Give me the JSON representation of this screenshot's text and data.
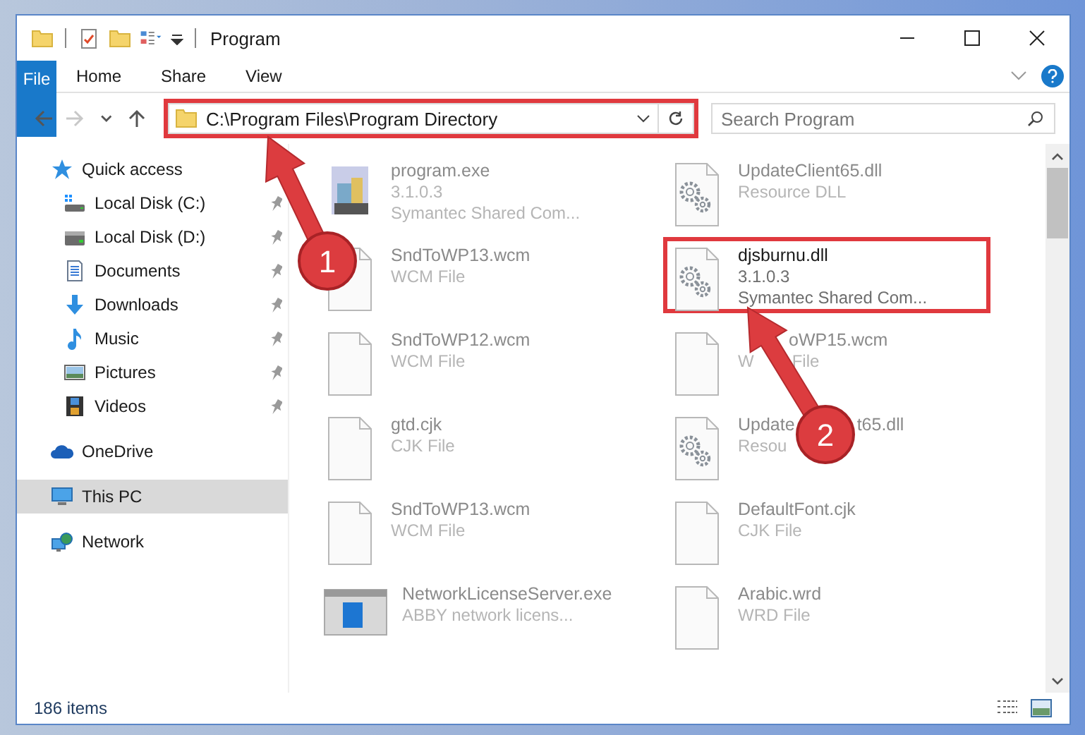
{
  "window": {
    "title": "Program"
  },
  "ribbon_tabs": [
    {
      "label": "File",
      "kind": "file"
    },
    {
      "label": "Home",
      "kind": "tab"
    },
    {
      "label": "Share",
      "kind": "tab"
    },
    {
      "label": "View",
      "kind": "tab"
    }
  ],
  "nav_buttons": [
    {
      "kind": "back",
      "disabled": false
    },
    {
      "kind": "forward",
      "disabled": true
    },
    {
      "kind": "recent",
      "disabled": false
    },
    {
      "kind": "up",
      "disabled": false
    }
  ],
  "address": {
    "value": "C:\\Program Files\\Program Directory",
    "highlighted": true
  },
  "search": {
    "placeholder": "Search Program"
  },
  "sidebar": {
    "items": [
      {
        "label": "Quick access",
        "kind": "star",
        "selected": false,
        "children": [
          {
            "label": "Local Disk (C:)",
            "kind": "drive-c",
            "pinned": true,
            "selected": false
          },
          {
            "label": "Local Disk (D:)",
            "kind": "drive",
            "pinned": true,
            "selected": false
          },
          {
            "label": "Documents",
            "kind": "documents",
            "pinned": true,
            "selected": false
          },
          {
            "label": "Downloads",
            "kind": "downloads",
            "pinned": true,
            "selected": false
          },
          {
            "label": "Music",
            "kind": "music",
            "pinned": true,
            "selected": false
          },
          {
            "label": "Pictures",
            "kind": "pictures",
            "pinned": true,
            "selected": false
          },
          {
            "label": "Videos",
            "kind": "videos",
            "pinned": true,
            "selected": false
          }
        ]
      },
      {
        "label": "OneDrive",
        "kind": "cloud",
        "selected": false
      },
      {
        "label": "This PC",
        "kind": "pc",
        "selected": true
      },
      {
        "label": "Network",
        "kind": "network",
        "selected": false
      }
    ]
  },
  "files": [
    {
      "name": "program.exe",
      "lines": [
        "3.1.0.3",
        "Symantec Shared Com..."
      ],
      "kind": "exe",
      "blurred": true,
      "highlighted": false
    },
    {
      "name": "UpdateClient65.dll",
      "lines": [
        "Resource DLL"
      ],
      "kind": "dll",
      "blurred": true,
      "highlighted": false
    },
    {
      "name": "SndToWP13.wcm",
      "lines": [
        "WCM File"
      ],
      "kind": "blank",
      "blurred": true,
      "highlighted": false
    },
    {
      "name": "djsburnu.dll",
      "lines": [
        "3.1.0.3",
        "Symantec Shared Com..."
      ],
      "kind": "dll",
      "blurred": false,
      "highlighted": true
    },
    {
      "name": "SndToWP12.wcm",
      "lines": [
        "WCM File"
      ],
      "kind": "blank",
      "blurred": true,
      "highlighted": false
    },
    {
      "name": "oWP15.wcm",
      "lines": [
        [
          "W",
          "File"
        ]
      ],
      "kind": "blank",
      "blurred": true,
      "highlighted": false
    },
    {
      "name": "gtd.cjk",
      "lines": [
        "CJK File"
      ],
      "kind": "blank",
      "blurred": true,
      "highlighted": false
    },
    {
      "name": [
        "Update",
        "t65.dll"
      ],
      "lines": [
        "Resou"
      ],
      "kind": "dll",
      "blurred": true,
      "highlighted": false
    },
    {
      "name": "SndToWP13.wcm",
      "lines": [
        "WCM File"
      ],
      "kind": "blank",
      "blurred": true,
      "highlighted": false
    },
    {
      "name": "DefaultFont.cjk",
      "lines": [
        "CJK File"
      ],
      "kind": "blank",
      "blurred": true,
      "highlighted": false
    },
    {
      "name": "NetworkLicenseServer.exe",
      "lines": [
        "ABBY network licens..."
      ],
      "kind": "app",
      "blurred": true,
      "highlighted": false
    },
    {
      "name": "Arabic.wrd",
      "lines": [
        "WRD File"
      ],
      "kind": "blank",
      "blurred": true,
      "highlighted": false
    }
  ],
  "status_bar": {
    "item_count": "186 items"
  },
  "callouts": [
    {
      "label": "1"
    },
    {
      "label": "2"
    }
  ]
}
